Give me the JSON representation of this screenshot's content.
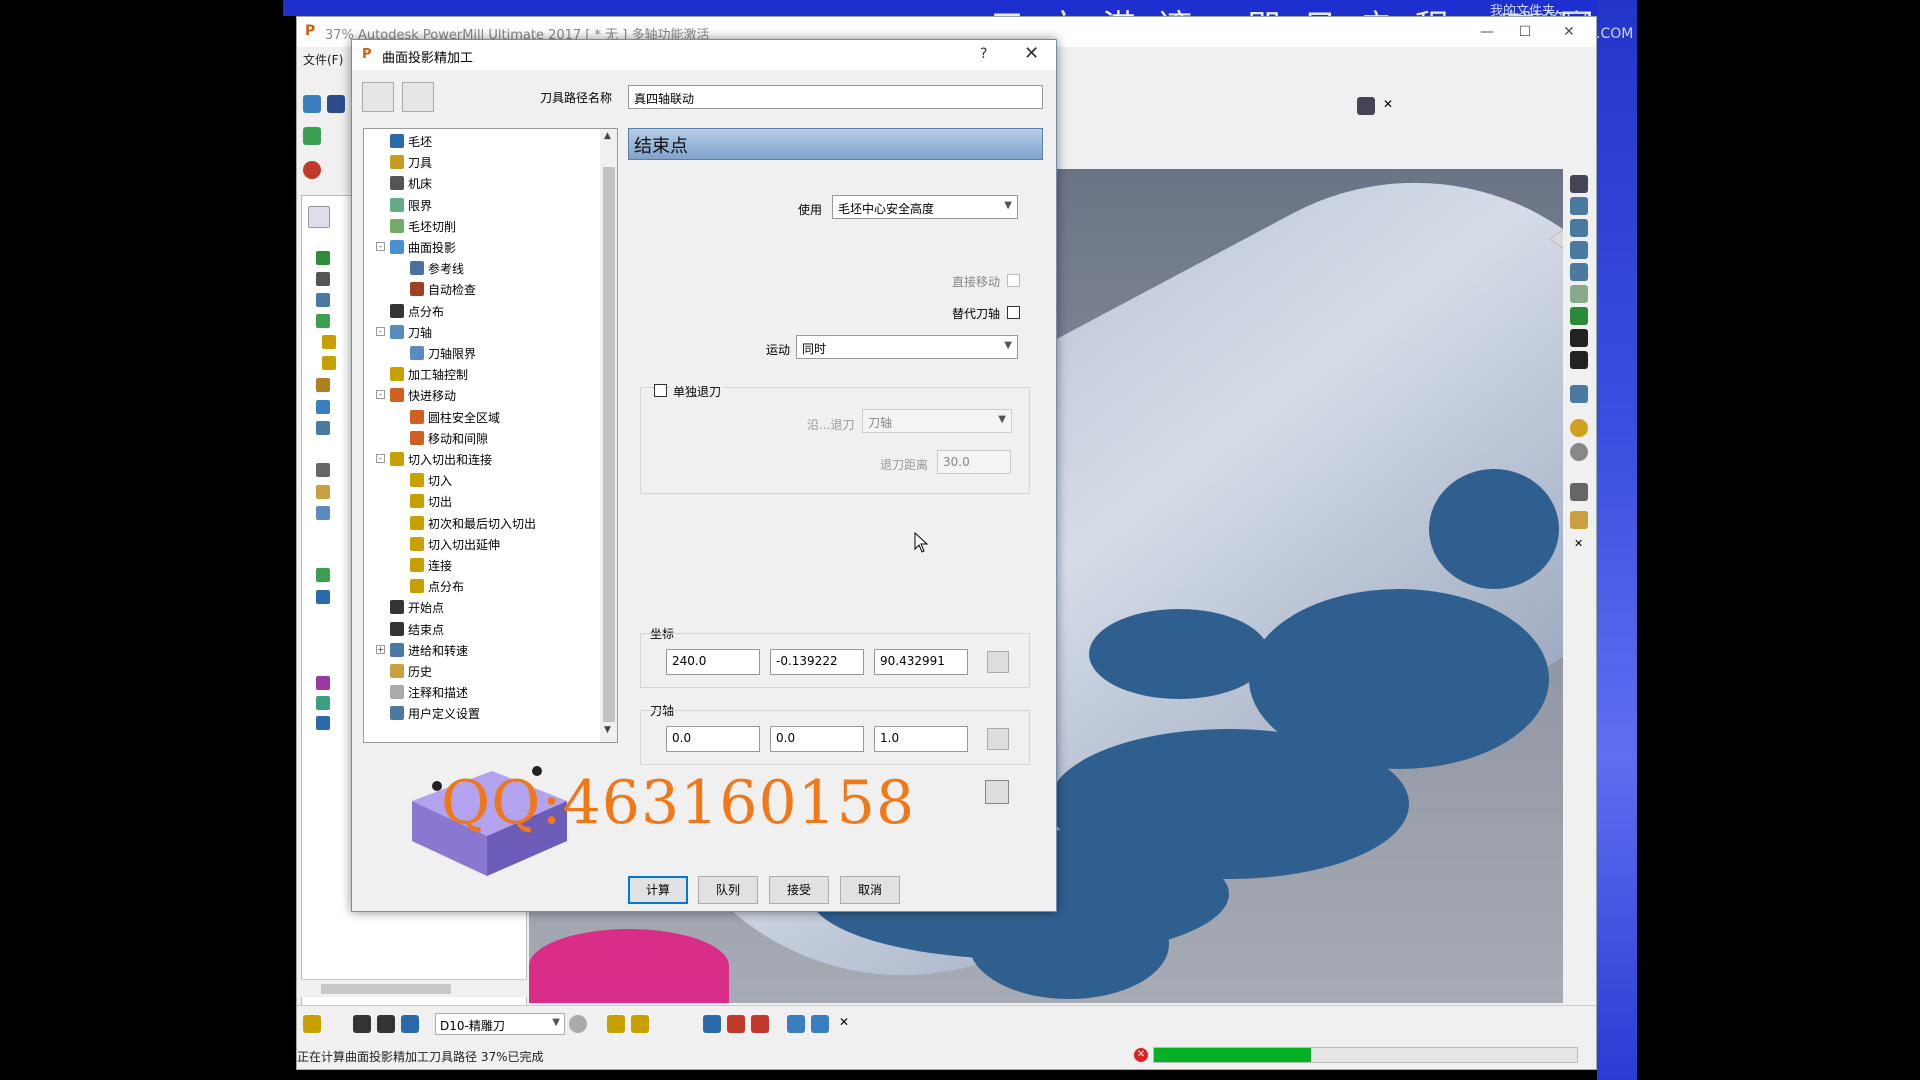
{
  "banner": {
    "text": "三方港湾   即日启程   二回",
    "right1": "我的文件夹",
    "right2": "电脑管家",
    "right3": ".COM"
  },
  "app": {
    "title": "37% Autodesk PowerMill Ultimate 2017    [ * 无 ]    多轴功能激活",
    "menu_file": "文件(F)",
    "logo": "P"
  },
  "bottom": {
    "tool_select": "D10-精雕刀",
    "status": "正在计算曲面投影精加工刀具路径  37%已完成",
    "progress": 0.37
  },
  "dialog": {
    "logo": "P",
    "title": "曲面投影精加工",
    "help": "?",
    "close": "✕",
    "toolpath_name_label": "刀具路径名称",
    "toolpath_name": "真四轴联动",
    "section_title": "结束点",
    "use_label": "使用",
    "use_value": "毛坯中心安全高度",
    "direct_move_label": "直接移动",
    "replace_axis_label": "替代刀轴",
    "motion_label": "运动",
    "motion_value": "同时",
    "separate_retract_label": "单独退刀",
    "along_label": "沿...退刀",
    "along_value": "刀轴",
    "retract_dist_label": "退刀距离",
    "retract_dist": "30.0",
    "coords_label": "坐标",
    "coords": [
      "240.0",
      "-0.139222",
      "90.432991"
    ],
    "axis_label": "刀轴",
    "axis": [
      "0.0",
      "0.0",
      "1.0"
    ],
    "watermark": "QQ:463160158",
    "buttons": {
      "calc": "计算",
      "queue": "队列",
      "accept": "接受",
      "cancel": "取消"
    },
    "tree": [
      {
        "label": "毛坯",
        "indent": 0,
        "color": "#2a6aa8",
        "exp": ""
      },
      {
        "label": "刀具",
        "indent": 0,
        "color": "#c89a20",
        "exp": ""
      },
      {
        "label": "机床",
        "indent": 0,
        "color": "#555",
        "exp": ""
      },
      {
        "label": "限界",
        "indent": 0,
        "color": "#6a8",
        "exp": ""
      },
      {
        "label": "毛坯切削",
        "indent": 0,
        "color": "#7a6",
        "exp": ""
      },
      {
        "label": "曲面投影",
        "indent": 0,
        "color": "#4a90d0",
        "exp": "-"
      },
      {
        "label": "参考线",
        "indent": 1,
        "color": "#4a6fa0",
        "exp": ""
      },
      {
        "label": "自动检查",
        "indent": 1,
        "color": "#a04020",
        "exp": ""
      },
      {
        "label": "点分布",
        "indent": 0,
        "color": "#333",
        "exp": ""
      },
      {
        "label": "刀轴",
        "indent": 0,
        "color": "#5a8ac0",
        "exp": "-"
      },
      {
        "label": "刀轴限界",
        "indent": 1,
        "color": "#5a8ac0",
        "exp": ""
      },
      {
        "label": "加工轴控制",
        "indent": 0,
        "color": "#c8a000",
        "exp": ""
      },
      {
        "label": "快进移动",
        "indent": 0,
        "color": "#d06020",
        "exp": "-"
      },
      {
        "label": "圆柱安全区域",
        "indent": 1,
        "color": "#d06020",
        "exp": ""
      },
      {
        "label": "移动和间隙",
        "indent": 1,
        "color": "#d06020",
        "exp": ""
      },
      {
        "label": "切入切出和连接",
        "indent": 0,
        "color": "#c8a000",
        "exp": "-"
      },
      {
        "label": "切入",
        "indent": 1,
        "color": "#c8a000",
        "exp": ""
      },
      {
        "label": "切出",
        "indent": 1,
        "color": "#c8a000",
        "exp": ""
      },
      {
        "label": "初次和最后切入切出",
        "indent": 1,
        "color": "#c8a000",
        "exp": ""
      },
      {
        "label": "切入切出延伸",
        "indent": 1,
        "color": "#c8a000",
        "exp": ""
      },
      {
        "label": "连接",
        "indent": 1,
        "color": "#c8a000",
        "exp": ""
      },
      {
        "label": "点分布",
        "indent": 1,
        "color": "#c8a000",
        "exp": ""
      },
      {
        "label": "开始点",
        "indent": 0,
        "color": "#333",
        "exp": ""
      },
      {
        "label": "结束点",
        "indent": 0,
        "color": "#333",
        "exp": ""
      },
      {
        "label": "进给和转速",
        "indent": 0,
        "color": "#4a7aa0",
        "exp": "+"
      },
      {
        "label": "历史",
        "indent": 0,
        "color": "#c8a040",
        "exp": ""
      },
      {
        "label": "注释和描述",
        "indent": 0,
        "color": "#aaa",
        "exp": ""
      },
      {
        "label": "用户定义设置",
        "indent": 0,
        "color": "#4a7aa0",
        "exp": ""
      }
    ]
  },
  "colors": {
    "accent": "#0078d7",
    "header_blue": "#7fa3cc",
    "relief_blue": "#2f5f8e",
    "progress_green": "#06b025",
    "watermark_orange": "#f07818"
  }
}
